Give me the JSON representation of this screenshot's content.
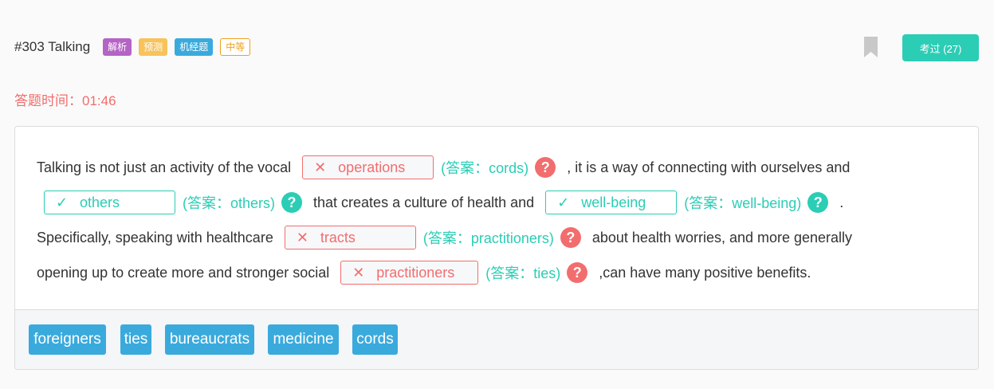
{
  "header": {
    "question_title": "#303 Talking",
    "badges": [
      "解析",
      "预测",
      "机经题",
      "中等"
    ],
    "bookmark_icon": "bookmark-icon",
    "exam_button": "考过 (27)"
  },
  "timer": {
    "label": "答题时间：",
    "value": "01:46"
  },
  "passage": {
    "line1": {
      "text_before": "Talking is not just an activity of the vocal",
      "blank1": {
        "user_answer": "operations",
        "status": "wrong",
        "answer_label": "(答案：cords)"
      },
      "text_after": ", it is a way of connecting with ourselves and"
    },
    "line2": {
      "blank2": {
        "user_answer": "others",
        "status": "correct",
        "answer_label": "(答案：others)"
      },
      "text_middle": "that creates a culture of health and",
      "blank3": {
        "user_answer": "well-being",
        "status": "correct",
        "answer_label": "(答案：well-being)"
      },
      "text_after": "."
    },
    "line3": {
      "text_before": "Specifically, speaking with healthcare",
      "blank4": {
        "user_answer": "tracts",
        "status": "wrong",
        "answer_label": "(答案：practitioners)"
      },
      "text_after": "about health worries, and more generally"
    },
    "line4": {
      "text_before": "opening up to create more and stronger social",
      "blank5": {
        "user_answer": "practitioners",
        "status": "wrong",
        "answer_label": "(答案：ties)"
      },
      "text_after": ",can have many positive benefits."
    },
    "wrong_mark": "✕",
    "right_mark": "✓",
    "help_glyph": "?"
  },
  "word_bank": [
    "foreigners",
    "ties",
    "bureaucrats",
    "medicine",
    "cords"
  ],
  "colors": {
    "wrong": "#f26d6d",
    "correct": "#2bcdb5",
    "chip": "#3aaadd",
    "exam_button": "#2bcdb5"
  }
}
